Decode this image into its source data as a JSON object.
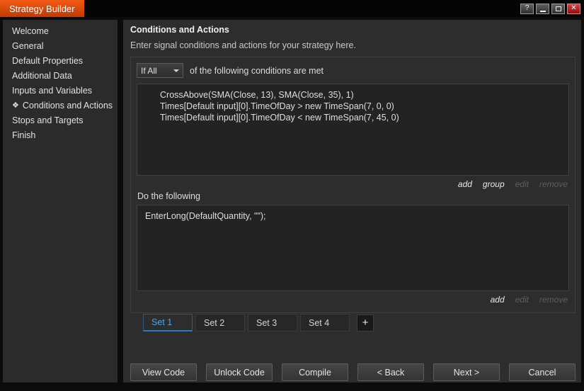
{
  "titlebar": {
    "title": "Strategy Builder",
    "help_icon": "?",
    "close_icon": "✕"
  },
  "sidebar": {
    "items": [
      {
        "label": "Welcome"
      },
      {
        "label": "General"
      },
      {
        "label": "Default Properties"
      },
      {
        "label": "Additional Data"
      },
      {
        "label": "Inputs and Variables"
      },
      {
        "label": "Conditions and Actions",
        "icon": "❖"
      },
      {
        "label": "Stops and Targets"
      },
      {
        "label": "Finish"
      }
    ]
  },
  "main": {
    "heading": "Conditions and Actions",
    "subtitle": "Enter signal conditions and actions for your strategy here.",
    "conditions": {
      "mode_value": "If All",
      "suffix": "of the following conditions are met",
      "items": [
        "CrossAbove(SMA(Close, 13), SMA(Close, 35), 1)",
        "Times[Default input][0].TimeOfDay > new TimeSpan(7, 0, 0)",
        "Times[Default input][0].TimeOfDay < new TimeSpan(7, 45, 0)"
      ],
      "links": {
        "add": "add",
        "group": "group",
        "edit": "edit",
        "remove": "remove"
      }
    },
    "actions": {
      "label": "Do the following",
      "items": [
        "EnterLong(DefaultQuantity, \"\");"
      ],
      "links": {
        "add": "add",
        "edit": "edit",
        "remove": "remove"
      }
    },
    "tabs": {
      "set1": "Set 1",
      "set2": "Set 2",
      "set3": "Set 3",
      "set4": "Set 4",
      "add": "+"
    },
    "footer": {
      "view_code": "View Code",
      "unlock_code": "Unlock Code",
      "compile": "Compile",
      "back": "< Back",
      "next": "Next >",
      "cancel": "Cancel"
    }
  },
  "colors": {
    "accent_orange": "#d8490b",
    "accent_blue": "#2d79c0",
    "close_red": "#a01515"
  }
}
